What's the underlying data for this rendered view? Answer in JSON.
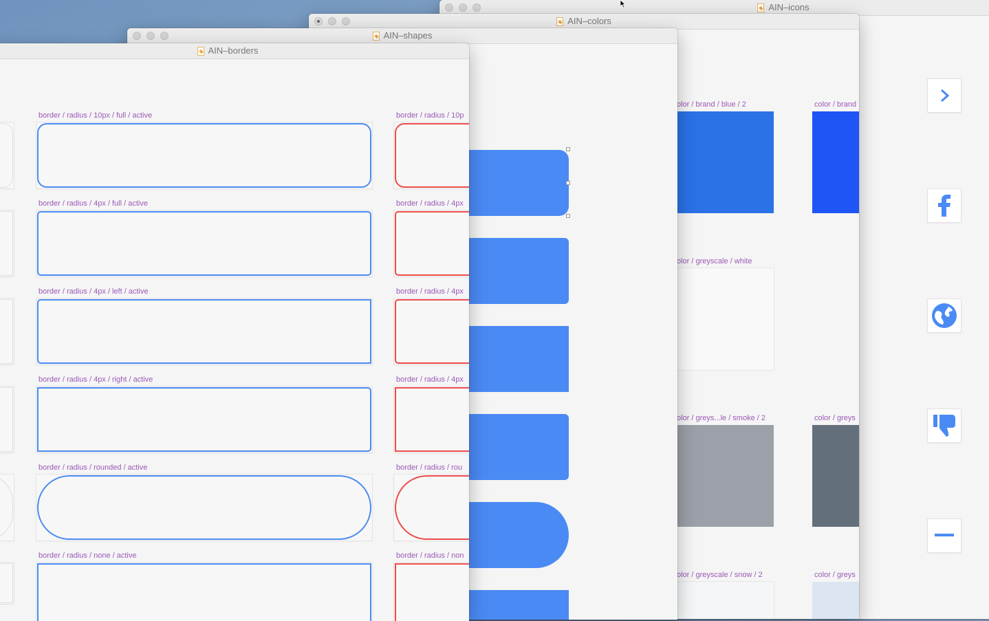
{
  "windows": {
    "icons": {
      "title": "AIN–icons"
    },
    "colors": {
      "title": "AIN–colors"
    },
    "shapes": {
      "title": "AIN–shapes"
    },
    "borders": {
      "title": "AIN–borders"
    }
  },
  "borders": {
    "left_labels": [
      "border / radius / 10px / full / active",
      "border / radius / 4px / full / active",
      "border / radius / 4px / left / active",
      "border / radius / 4px / right / active",
      "border / radius / rounded / active",
      "border / radius / none / active"
    ],
    "right_labels": [
      "border / radius / 10p",
      "border / radius / 4px",
      "border / radius / 4px",
      "border / radius / 4px",
      "border / radius / rou",
      "border / radius / non"
    ],
    "colors": {
      "active": "#4a8bf0",
      "error": "#ef4a4a"
    }
  },
  "colors": {
    "labels": [
      "olor / brand / blue / 2",
      "color / brand",
      "olor / greyscale / white",
      "olor / greys...le / smoke / 2",
      "color / greys",
      "olor / greyscale / snow / 2",
      "color / greys"
    ],
    "swatches": {
      "brand_blue_2": "#2a72e6",
      "brand": "#1f54f5",
      "white": "#f9f9f9",
      "smoke_2": "#9ba0a9",
      "grey_dark": "#646f7c",
      "snow_2": "#f4f6f8",
      "snow_light": "#dce6f3"
    }
  },
  "shapes": {
    "fill": "#4a8af4"
  },
  "icons": {
    "items": [
      "chevron-right-icon",
      "facebook-icon",
      "globe-icon",
      "thumbs-down-icon",
      "minus-icon"
    ],
    "color": "#4a8af4"
  }
}
